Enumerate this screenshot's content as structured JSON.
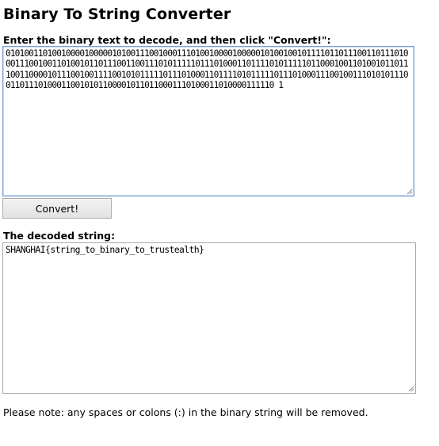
{
  "page": {
    "title": "Binary To String Converter"
  },
  "input": {
    "label": "Enter the binary text to decode, and then click \"Convert!\":",
    "value": "0101001101001000010000010100111001000111010010000100000101001001011110110111001101110100011100100110100101101110011001110101111101110100011011110101111101100010011010010110111001100001011100100111100101011111011101000110111101011111011101000111001001110101011100110111010001100101011000010110110001110100011010000111110 1"
  },
  "convert": {
    "label": "Convert!"
  },
  "output": {
    "label": "The decoded string:",
    "value": "SHANGHAI{string_to_binary_to_trustealth}"
  },
  "note": {
    "text": "Please note: any spaces or colons (:) in the binary string will be removed."
  },
  "colors": {
    "focus_border": "#7a9cd3",
    "textarea_border": "#a9a9a9",
    "button_border": "#adadad"
  }
}
